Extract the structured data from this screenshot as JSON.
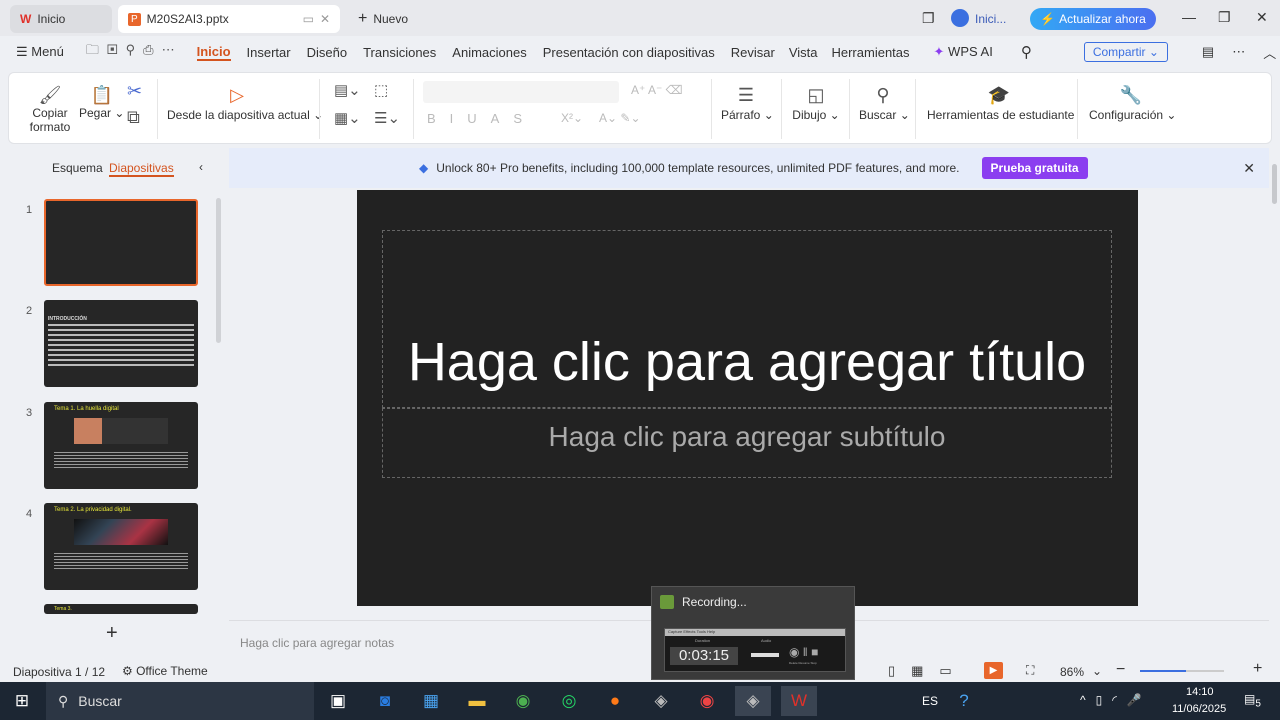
{
  "tabs": {
    "home": "Inicio",
    "file": "M20S2AI3.pptx",
    "new": "Nuevo"
  },
  "titlebar": {
    "signin": "Inici...",
    "upgrade": "Actualizar ahora"
  },
  "menu": {
    "menu": "Menú",
    "items": [
      "Inicio",
      "Insertar",
      "Diseño",
      "Transiciones",
      "Animaciones",
      "Presentación con diapositivas",
      "Revisar",
      "Vista",
      "Herramientas"
    ],
    "wps_ai": "WPS AI",
    "share": "Compartir"
  },
  "ribbon": {
    "copy_format_1": "Copiar",
    "copy_format_2": "formato",
    "paste": "Pegar",
    "from_current": "Desde la diapositiva actual",
    "paragraph": "Párrafo",
    "drawing": "Dibujo",
    "find": "Buscar",
    "student_tools": "Herramientas de estudiante",
    "settings": "Configuración"
  },
  "sidebar": {
    "tab_outline": "Esquema",
    "tab_slides": "Diapositivas",
    "slides": [
      {
        "n": "1",
        "title": ""
      },
      {
        "n": "2",
        "title": "INTRODUCCIÓN"
      },
      {
        "n": "3",
        "title": "Tema 1. La huella digital"
      },
      {
        "n": "4",
        "title": "Tema 2. La privacidad digital."
      },
      {
        "n": "5",
        "title": "Tema 3."
      }
    ]
  },
  "banner": {
    "text": "Unlock 80+ Pro benefits, including 100,000 template resources, unlimited PDF features, and more.",
    "cta": "Prueba gratuita"
  },
  "slide": {
    "title": "Haga clic para agregar título",
    "subtitle": "Haga clic para agregar subtítulo"
  },
  "notes": {
    "placeholder": "Haga clic para agregar notas"
  },
  "status": {
    "slide": "Diapositiva",
    "slide_count": "1 / 12",
    "theme": "Office Theme",
    "zoom": "86%",
    "zoom_fraction": 0.55
  },
  "recording": {
    "title": "Recording...",
    "menu": [
      "Capture",
      "Effects",
      "Tools",
      "Help"
    ],
    "duration_label": "Duration",
    "duration": "0:03:15",
    "audio_label": "Audio",
    "buttons": [
      "Delete",
      "Resume",
      "Stop"
    ]
  },
  "taskbar": {
    "search": "Buscar",
    "lang": "ES",
    "time": "14:10",
    "date": "11/06/2025",
    "notifications": "5"
  },
  "colors": {
    "accent": "#d4541f",
    "purple": "#8b3ef0",
    "blue": "#2f7cf6"
  }
}
